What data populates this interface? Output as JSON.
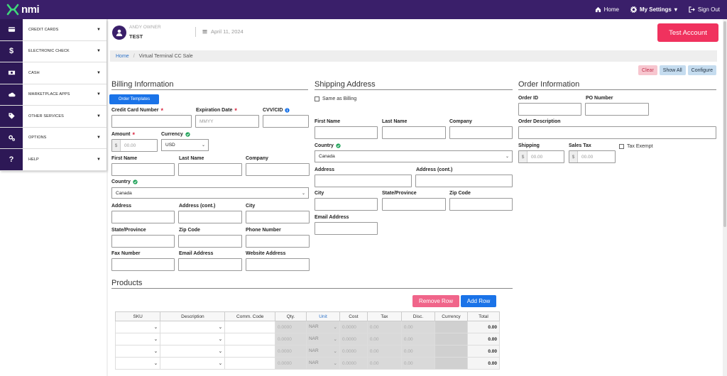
{
  "topbar": {
    "brand": "nmi",
    "nav": [
      {
        "label": "Home",
        "icon": "home-icon"
      },
      {
        "label": "My Settings",
        "icon": "gear-icon",
        "caret": "▾"
      },
      {
        "label": "Sign Out",
        "icon": "sign-out-icon"
      }
    ]
  },
  "sidebar": {
    "items": [
      {
        "label": "CREDIT CARDS",
        "icon": "credit-card-icon"
      },
      {
        "label": "ELECTRONIC CHECK",
        "icon": "dollar-icon",
        "glyph": "$"
      },
      {
        "label": "CASH",
        "icon": "cash-icon"
      },
      {
        "label": "MARKETPLACE APPS",
        "icon": "cloud-icon"
      },
      {
        "label": "OTHER SERVICES",
        "icon": "tag-icon"
      },
      {
        "label": "OPTIONS",
        "icon": "cogs-icon"
      },
      {
        "label": "HELP",
        "icon": "question-icon",
        "glyph": "?"
      }
    ]
  },
  "user": {
    "name": "ANDY OWNER",
    "role": "TEST",
    "date": "April 11, 2024"
  },
  "test_account_label": "Test Account",
  "breadcrumb": {
    "home": "Home",
    "sep": "/",
    "current": "Virtual Terminal CC Sale"
  },
  "actions": {
    "clear": "Clear",
    "show_all": "Show All",
    "configure": "Configure"
  },
  "billing": {
    "title": "Billing Information",
    "order_templates": "Order Templates",
    "cc_number": "Credit Card Number",
    "expiration": "Expiration Date",
    "expiration_ph": "MMYY",
    "cvv": "CVV/CID",
    "amount": "Amount",
    "amount_prefix": "$",
    "amount_ph": "00.00",
    "currency": "Currency",
    "currency_value": "USD",
    "first_name": "First Name",
    "last_name": "Last Name",
    "company": "Company",
    "country": "Country",
    "country_value": "Canada",
    "address": "Address",
    "address2": "Address (cont.)",
    "city": "City",
    "state": "State/Province",
    "zip": "Zip Code",
    "phone": "Phone Number",
    "fax": "Fax Number",
    "email": "Email Address",
    "website": "Website Address"
  },
  "shipping": {
    "title": "Shipping Address",
    "same_as_billing": "Same as Billing",
    "first_name": "First Name",
    "last_name": "Last Name",
    "company": "Company",
    "country": "Country",
    "country_value": "Canada",
    "address": "Address",
    "address2": "Address (cont.)",
    "city": "City",
    "state": "State/Province",
    "zip": "Zip Code",
    "email": "Email Address"
  },
  "order": {
    "title": "Order Information",
    "order_id": "Order ID",
    "po_number": "PO Number",
    "description": "Order Description",
    "shipping": "Shipping",
    "shipping_prefix": "$",
    "shipping_ph": "00.00",
    "sales_tax": "Sales Tax",
    "tax_prefix": "$",
    "tax_ph": "00.00",
    "tax_exempt": "Tax Exempt"
  },
  "products": {
    "title": "Products",
    "remove_row": "Remove Row",
    "add_row": "Add Row",
    "columns": [
      "SKU",
      "Description",
      "Comm. Code",
      "Qty.",
      "Unit",
      "Cost",
      "Tax",
      "Disc.",
      "Currency",
      "Total"
    ],
    "rows": [
      {
        "qty": "0.0000",
        "unit": "NAR",
        "cost": "0.0000",
        "tax": "0.00",
        "disc": "0.00",
        "total": "0.00"
      },
      {
        "qty": "0.0000",
        "unit": "NAR",
        "cost": "0.0000",
        "tax": "0.00",
        "disc": "0.00",
        "total": "0.00"
      },
      {
        "qty": "0.0000",
        "unit": "NAR",
        "cost": "0.0000",
        "tax": "0.00",
        "disc": "0.00",
        "total": "0.00"
      },
      {
        "qty": "0.0000",
        "unit": "NAR",
        "cost": "0.0000",
        "tax": "0.00",
        "disc": "0.00",
        "total": "0.00"
      }
    ]
  }
}
